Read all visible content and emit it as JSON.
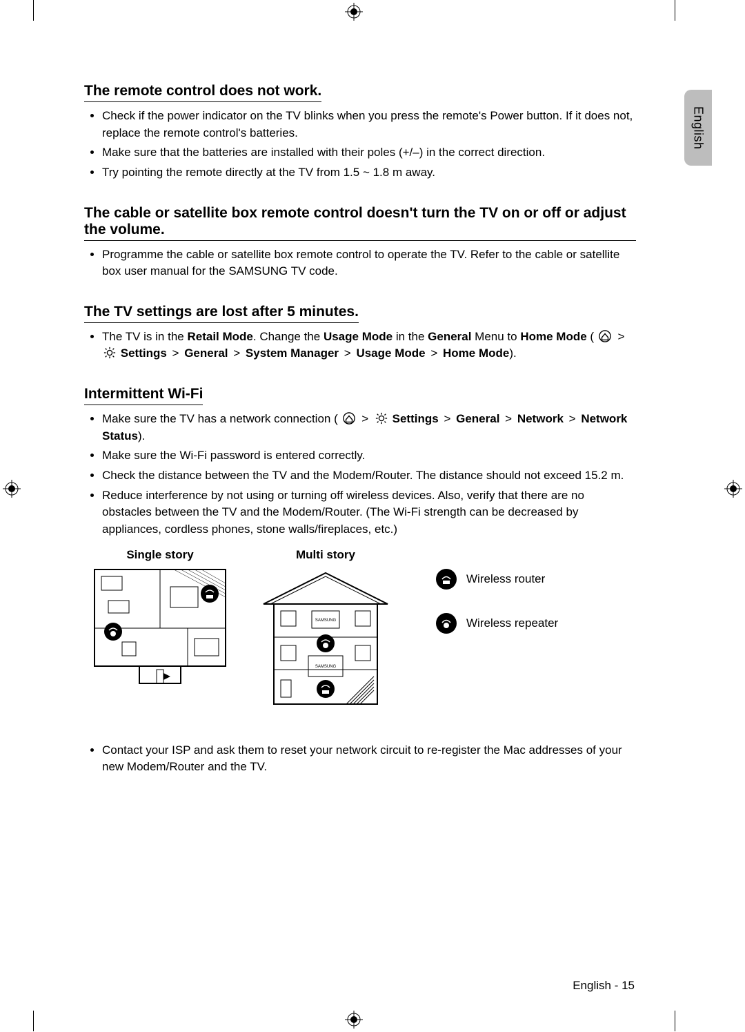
{
  "lang_tab": "English",
  "sections": {
    "remote": {
      "title": "The remote control does not work.",
      "b1": "Check if the power indicator on the TV blinks when you press the remote's Power button. If it does not, replace the remote control's batteries.",
      "b2": "Make sure that the batteries are installed with their poles (+/–) in the correct direction.",
      "b3": "Try pointing the remote directly at the TV from 1.5 ~ 1.8 m away."
    },
    "cable": {
      "title": "The cable or satellite box remote control doesn't turn the TV on or off or adjust the volume.",
      "b1": "Programme the cable or satellite box remote control to operate the TV. Refer to the cable or satellite box user manual for the SAMSUNG TV code."
    },
    "settings": {
      "title": "The TV settings are lost after 5 minutes.",
      "b1_p1": "The TV is in the ",
      "b1_retail": "Retail Mode",
      "b1_p2": ". Change the ",
      "b1_usage1": "Usage Mode",
      "b1_p3": " in the ",
      "b1_general1": "General",
      "b1_p4": " Menu to ",
      "b1_home1": "Home Mode",
      "b1_p5": " (",
      "b1_gt": ">",
      "b1_settings": "Settings",
      "b1_general2": "General",
      "b1_sysmgr": "System Manager",
      "b1_usage2": "Usage Mode",
      "b1_home2": "Home Mode",
      "b1_p6": ")."
    },
    "wifi": {
      "title": "Intermittent Wi-Fi",
      "b1_p1": "Make sure the TV has a network connection (",
      "gt": ">",
      "b1_settings": "Settings",
      "b1_general": "General",
      "b1_network": "Network",
      "b1_status": "Network Status",
      "b1_p2": ").",
      "b2": "Make sure the Wi-Fi password is entered correctly.",
      "b3": "Check the distance between the TV and the Modem/Router. The distance should not exceed 15.2 m.",
      "b4": "Reduce interference by not using or turning off wireless devices. Also, verify that there are no obstacles between the TV and the Modem/Router. (The Wi-Fi strength can be decreased by appliances, cordless phones, stone walls/fireplaces, etc.)",
      "single_story": "Single story",
      "multi_story": "Multi story",
      "legend_router": "Wireless router",
      "legend_repeater": "Wireless repeater",
      "b5": "Contact your ISP and ask them to reset your network circuit to re-register the Mac addresses of your new Modem/Router and the TV."
    }
  },
  "footer": "English - 15"
}
